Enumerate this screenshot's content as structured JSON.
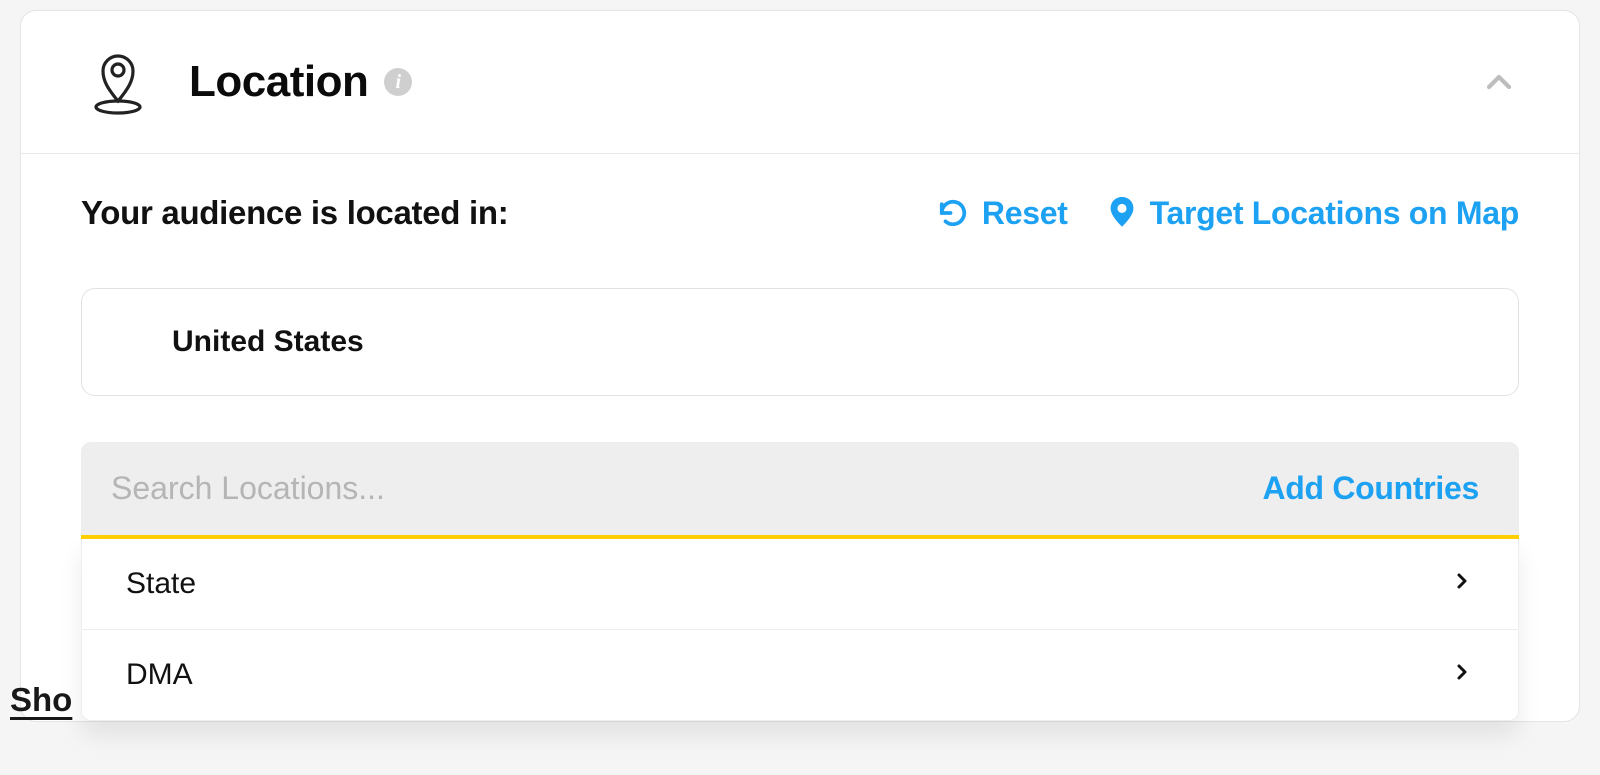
{
  "header": {
    "title": "Location",
    "info_glyph": "i"
  },
  "body": {
    "audience_label": "Your audience is located in:",
    "reset_label": "Reset",
    "map_label": "Target Locations on Map",
    "selected_country": "United States",
    "search_placeholder": "Search Locations...",
    "add_countries_label": "Add Countries"
  },
  "dropdown": {
    "items": [
      {
        "label": "State"
      },
      {
        "label": "DMA"
      }
    ]
  },
  "footer": {
    "truncated_link": "Sho"
  },
  "colors": {
    "accent_blue": "#1da1f2",
    "accent_yellow": "#ffcf00"
  }
}
